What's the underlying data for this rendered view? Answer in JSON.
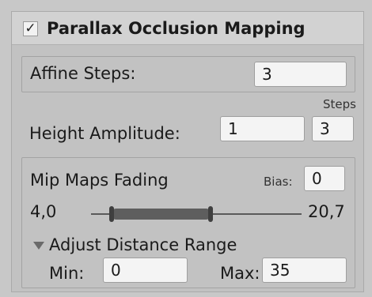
{
  "section": {
    "title": "Parallax Occlusion Mapping",
    "enabled_check": "✓"
  },
  "affine": {
    "label": "Affine Steps:",
    "value": "3"
  },
  "height": {
    "steps_label": "Steps",
    "label": "Height Amplitude:",
    "amplitude_value": "1",
    "steps_value": "3"
  },
  "mip": {
    "title": "Mip Maps Fading",
    "bias_label": "Bias:",
    "bias_value": "0",
    "range_min": "4,0",
    "range_max": "20,7",
    "foldout_label": "Adjust Distance Range",
    "min_label": "Min:",
    "min_value": "0",
    "max_label": "Max:",
    "max_value": "35"
  },
  "colors": {
    "background": "#c8c8c8",
    "field": "#f4f4f4",
    "slider": "#5e5e5e"
  },
  "icons": [
    "checkbox-check-icon",
    "foldout-triangle-icon"
  ]
}
